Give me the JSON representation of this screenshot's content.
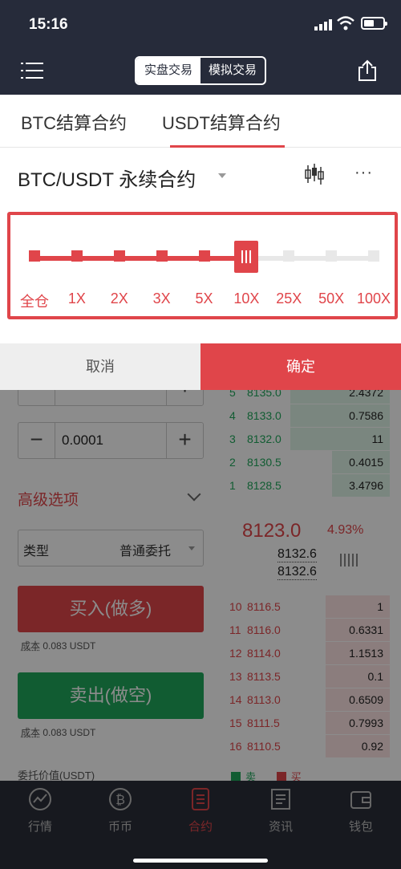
{
  "status": {
    "time": "15:16"
  },
  "nav": {
    "seg_real": "实盘交易",
    "seg_sim": "模拟交易"
  },
  "tabs": [
    {
      "label": "BTC结算合约"
    },
    {
      "label": "USDT结算合约"
    }
  ],
  "pair": {
    "title": "BTC/USDT 永续合约"
  },
  "form": {
    "qty_value": "0.0001",
    "advanced_label": "高级选项",
    "type_label": "类型",
    "type_value": "普通委托",
    "buy_label": "买入(做多)",
    "sell_label": "卖出(做空)",
    "cost_label": "成本",
    "cost_buy": "0.083 USDT",
    "cost_sell": "0.083 USDT",
    "entrust_label": "委托价值(USDT)"
  },
  "orderbook": {
    "asks": [
      {
        "n": "5",
        "price": "8135.0",
        "qty": "2.4372",
        "depth": 0.62
      },
      {
        "n": "4",
        "price": "8133.0",
        "qty": "0.7586",
        "depth": 0.62
      },
      {
        "n": "3",
        "price": "8132.0",
        "qty": "11",
        "depth": 0.62
      },
      {
        "n": "2",
        "price": "8130.5",
        "qty": "0.4015",
        "depth": 0.36
      },
      {
        "n": "1",
        "price": "8128.5",
        "qty": "3.4796",
        "depth": 0.36
      }
    ],
    "last_price": "8123.0",
    "change": "4.93%",
    "mark_price_1": "8132.6",
    "mark_price_2": "8132.6",
    "bids": [
      {
        "n": "10",
        "price": "8116.5",
        "qty": "1",
        "depth": 0.4
      },
      {
        "n": "11",
        "price": "8116.0",
        "qty": "0.6331",
        "depth": 0.4
      },
      {
        "n": "12",
        "price": "8114.0",
        "qty": "1.1513",
        "depth": 0.4
      },
      {
        "n": "13",
        "price": "8113.5",
        "qty": "0.1",
        "depth": 0.4
      },
      {
        "n": "14",
        "price": "8113.0",
        "qty": "0.6509",
        "depth": 0.4
      },
      {
        "n": "15",
        "price": "8111.5",
        "qty": "0.7993",
        "depth": 0.4
      },
      {
        "n": "16",
        "price": "8110.5",
        "qty": "0.92",
        "depth": 0.4
      }
    ],
    "legend_sell": "卖",
    "legend_buy": "买"
  },
  "leverage": {
    "options": [
      "全仓",
      "1X",
      "2X",
      "3X",
      "5X",
      "10X",
      "25X",
      "50X",
      "100X"
    ],
    "selected_index": 5,
    "cancel_label": "取消",
    "confirm_label": "确定"
  },
  "tabbar": [
    {
      "label": "行情",
      "icon": "chart-line-icon"
    },
    {
      "label": "币币",
      "icon": "bitcoin-icon"
    },
    {
      "label": "合约",
      "icon": "contract-icon"
    },
    {
      "label": "资讯",
      "icon": "news-icon"
    },
    {
      "label": "钱包",
      "icon": "wallet-icon"
    }
  ],
  "colors": {
    "accent": "#e0454a",
    "green": "#1fa85c",
    "dark": "#262b3a"
  }
}
